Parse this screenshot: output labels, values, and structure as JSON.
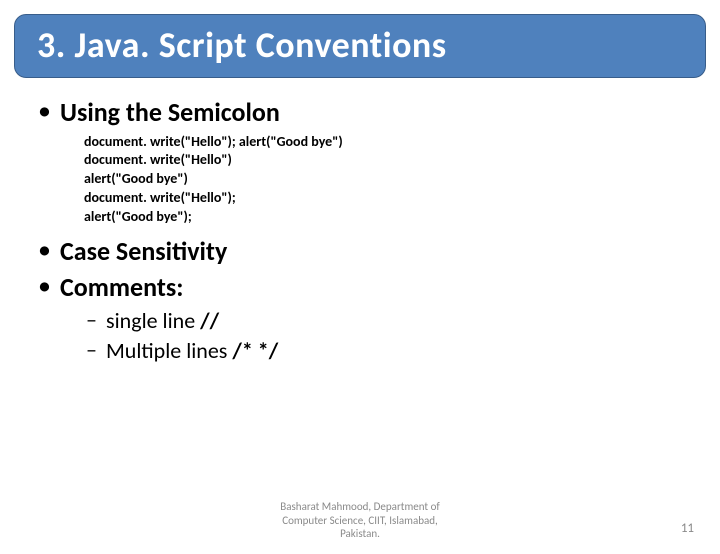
{
  "title": "3. Java. Script Conventions",
  "bullets": {
    "semicolon": {
      "heading": "Using the Semicolon",
      "code": [
        "document. write(\"Hello\"); alert(\"Good bye\")",
        "document. write(\"Hello\")",
        "alert(\"Good bye\")",
        "document. write(\"Hello\");",
        "alert(\"Good bye\");"
      ]
    },
    "case": {
      "heading": "Case Sensitivity"
    },
    "comments": {
      "heading": "Comments:",
      "sub": [
        {
          "text": "single line ",
          "bold": "//"
        },
        {
          "text": "Multiple lines ",
          "bold": "/* */"
        }
      ]
    }
  },
  "footer": {
    "line1": "Basharat Mahmood, Department of",
    "line2": "Computer Science, CIIT, Islamabad,",
    "line3": "Pakistan."
  },
  "page_number": "11"
}
